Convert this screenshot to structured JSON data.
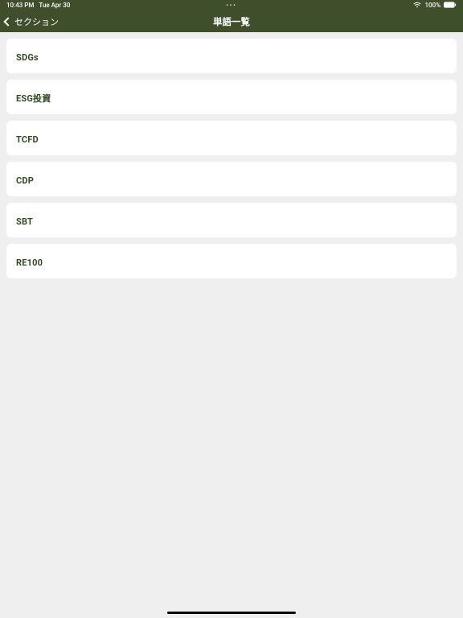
{
  "status": {
    "time": "10:43 PM",
    "date": "Tue Apr 30",
    "center": "•••",
    "battery": "100%"
  },
  "nav": {
    "back_label": "セクション",
    "title": "単語一覧"
  },
  "items": [
    {
      "label": "SDGs"
    },
    {
      "label": "ESG投資"
    },
    {
      "label": "TCFD"
    },
    {
      "label": "CDP"
    },
    {
      "label": "SBT"
    },
    {
      "label": "RE100"
    }
  ]
}
